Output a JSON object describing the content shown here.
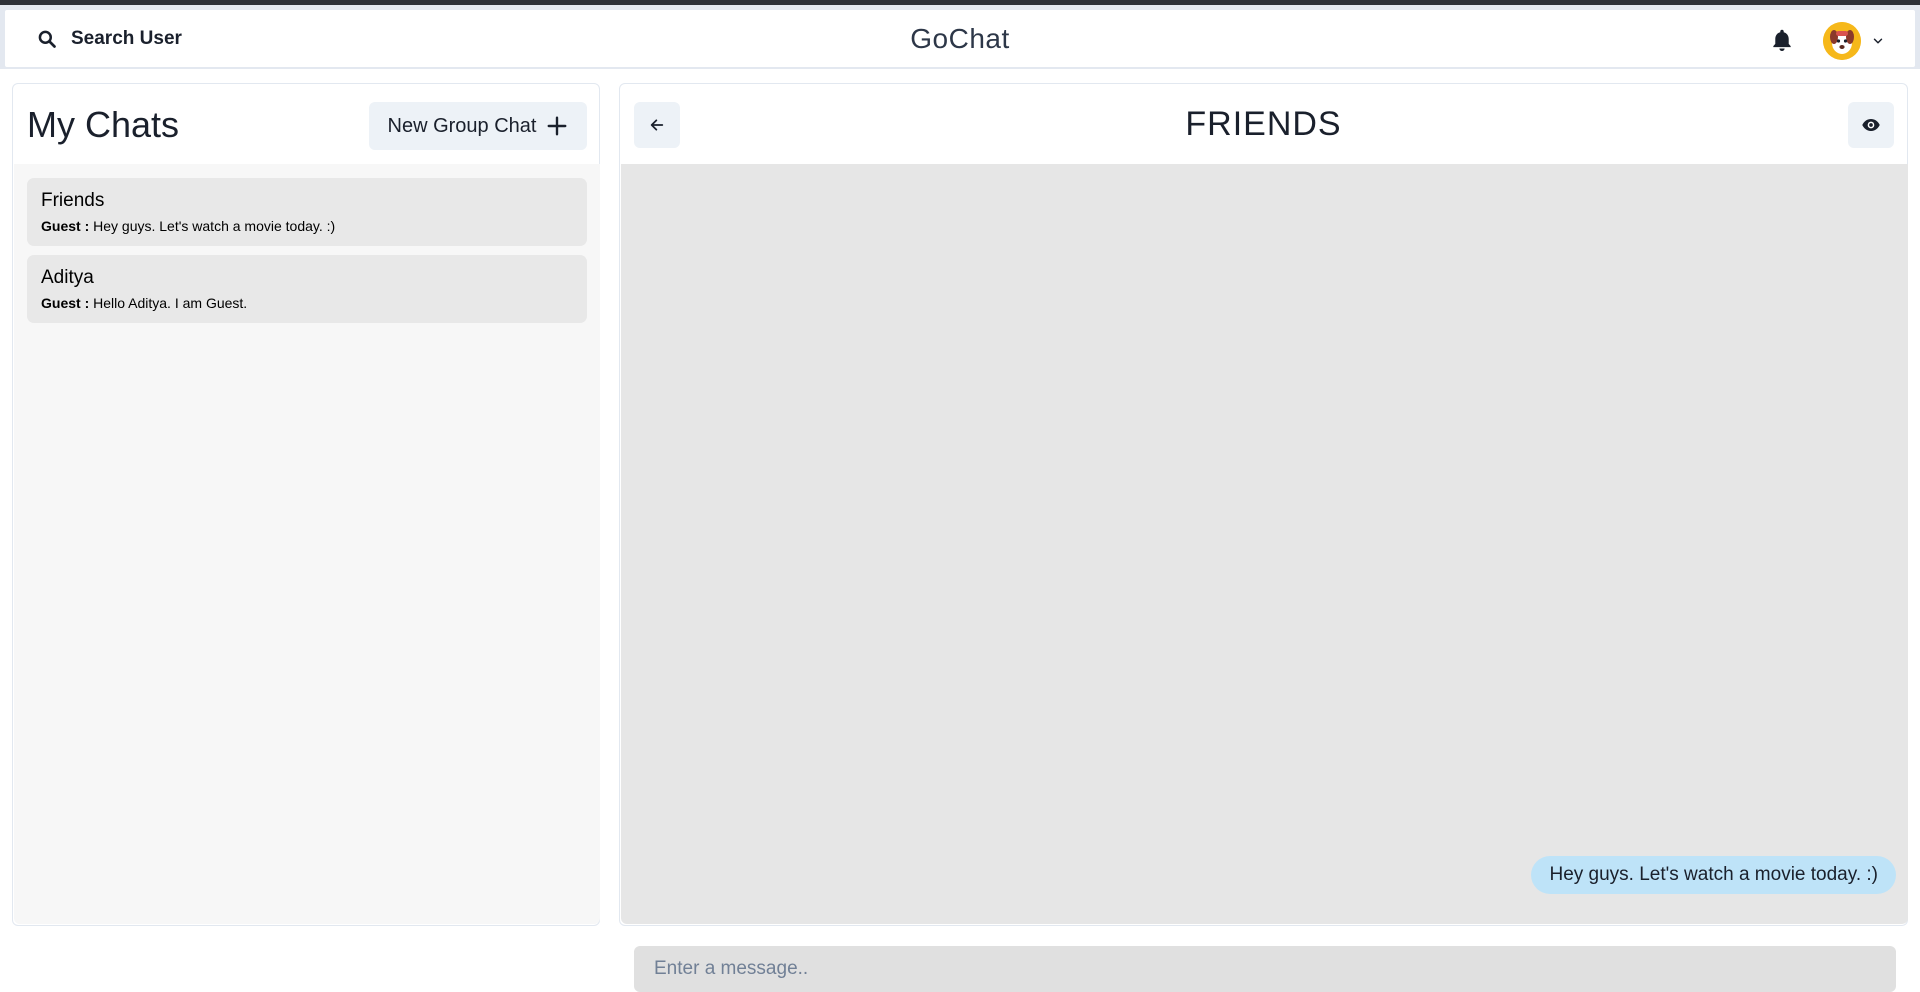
{
  "header": {
    "search_label": "Search User",
    "brand": "GoChat",
    "icons": {
      "search": "search-icon",
      "notifications": "bell-icon",
      "avatar": "avatar-icon",
      "menu": "chevron-down-icon"
    }
  },
  "sidebar": {
    "title": "My Chats",
    "new_group_label": "New Group Chat",
    "chats": [
      {
        "name": "Friends",
        "last_sender": "Guest :",
        "last_message": "Hey guys. Let's watch a movie today. :)"
      },
      {
        "name": "Aditya",
        "last_sender": "Guest :",
        "last_message": "Hello Aditya. I am Guest."
      }
    ]
  },
  "conversation": {
    "title": "FRIENDS",
    "messages": [
      {
        "text": "Hey guys. Let's watch a movie today. :)",
        "own": true
      }
    ],
    "input_placeholder": "Enter a message..",
    "input_value": ""
  },
  "colors": {
    "accent_bubble": "#bee3f8",
    "avatar_bg": "#f6b81a",
    "panel_bg": "#e6e6e6",
    "button_bg": "#edf2f7"
  }
}
